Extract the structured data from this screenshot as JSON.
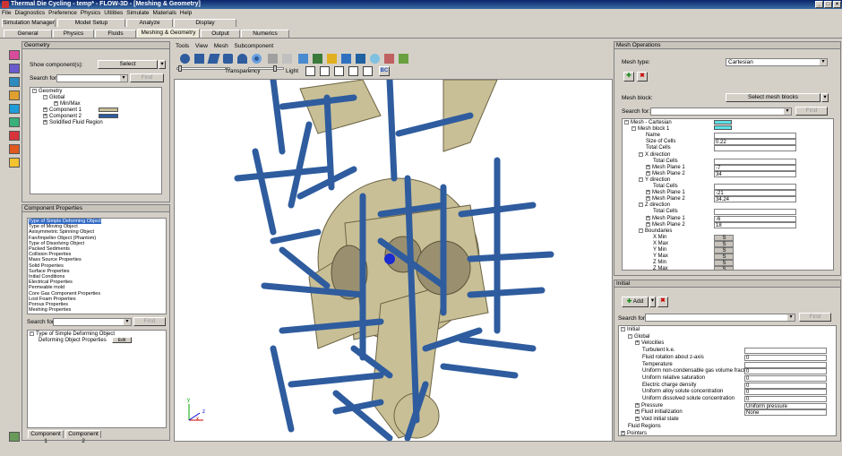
{
  "window": {
    "title": "Thermal Die Cycling - temp* - FLOW-3D - [Meshing & Geometry]"
  },
  "menu": [
    "File",
    "Diagnostics",
    "Preference",
    "Physics",
    "Utilities",
    "Simulate",
    "Materials",
    "Help"
  ],
  "tabs_top": [
    "Simulation Manager",
    "Model Setup",
    "Analyze",
    "Display"
  ],
  "tabs_sub": [
    "General",
    "Physics",
    "Fluids",
    "Meshing & Geometry",
    "Output",
    "Numerics"
  ],
  "geometry": {
    "title": "Geometry",
    "show_label": "Show component(s):",
    "show_value": "Select",
    "search_label": "Search for:",
    "find": "Find",
    "tree": [
      "Geometry",
      "Global",
      "Min/Max",
      "Component 1",
      "Component 2",
      "Solidified Fluid Region"
    ]
  },
  "component_properties": {
    "title": "Component Properties",
    "items": [
      "Type of Simple Deforming Object",
      "Type of Moving Object",
      "Axisymmetric Spinning Object",
      "Fan/Impeller Object (Phantom)",
      "Type of Dissolving Object",
      "Packed Sediments",
      "Collision Properties",
      "Mass Source Properties",
      "Solid Properties",
      "Surface Properties",
      "Initial Conditions",
      "Electrical Properties",
      "Permeable mold",
      "Core Gas Component Properties",
      "Lost Foam Properties",
      "Porous Properties",
      "Meshing Properties"
    ],
    "search_label": "Search for:",
    "find": "Find",
    "subtree": [
      "Type of Simple Deforming Object",
      "Deforming Object Properties"
    ],
    "edit": "Edit",
    "tabs": [
      "Component 1",
      "Component 2"
    ]
  },
  "toolbar": {
    "menus": [
      "Tools",
      "View",
      "Mesh",
      "Subcomponent"
    ],
    "transparency": "Transparency",
    "light": "Light",
    "bc": "BC"
  },
  "mesh_ops": {
    "title": "Mesh Operations",
    "mesh_type_label": "Mesh type:",
    "mesh_type": "Cartesian",
    "mesh_block_label": "Mesh block:",
    "select_blocks": "Select mesh blocks",
    "search_label": "Search for:",
    "find": "Find",
    "rows": [
      {
        "label": "Mesh - Cartesian",
        "ind": 0,
        "toggle": "-",
        "value": ""
      },
      {
        "label": "Mesh block 1",
        "ind": 1,
        "toggle": "-",
        "value": ""
      },
      {
        "label": "Name",
        "ind": 3,
        "toggle": "",
        "value": ""
      },
      {
        "label": "Size of Cells",
        "ind": 3,
        "toggle": "",
        "value": "0.22"
      },
      {
        "label": "Total Cells",
        "ind": 3,
        "toggle": "",
        "value": ""
      },
      {
        "label": "X direction",
        "ind": 2,
        "toggle": "-",
        "value": ""
      },
      {
        "label": "Total Cells",
        "ind": 4,
        "toggle": "",
        "value": ""
      },
      {
        "label": "Mesh Plane 1",
        "ind": 3,
        "toggle": "+",
        "value": "-7"
      },
      {
        "label": "Mesh Plane 2",
        "ind": 3,
        "toggle": "+",
        "value": "34"
      },
      {
        "label": "Y direction",
        "ind": 2,
        "toggle": "-",
        "value": ""
      },
      {
        "label": "Total Cells",
        "ind": 4,
        "toggle": "",
        "value": ""
      },
      {
        "label": "Mesh Plane 1",
        "ind": 3,
        "toggle": "+",
        "value": "-21"
      },
      {
        "label": "Mesh Plane 2",
        "ind": 3,
        "toggle": "+",
        "value": "34.24"
      },
      {
        "label": "Z direction",
        "ind": 2,
        "toggle": "-",
        "value": ""
      },
      {
        "label": "Total Cells",
        "ind": 4,
        "toggle": "",
        "value": ""
      },
      {
        "label": "Mesh Plane 1",
        "ind": 3,
        "toggle": "+",
        "value": "-6"
      },
      {
        "label": "Mesh Plane 2",
        "ind": 3,
        "toggle": "+",
        "value": "18"
      },
      {
        "label": "Boundaries",
        "ind": 2,
        "toggle": "-",
        "value": ""
      },
      {
        "label": "X Min",
        "ind": 4,
        "toggle": "",
        "value": "S"
      },
      {
        "label": "X Max",
        "ind": 4,
        "toggle": "",
        "value": "S"
      },
      {
        "label": "Y Min",
        "ind": 4,
        "toggle": "",
        "value": "S"
      },
      {
        "label": "Y Max",
        "ind": 4,
        "toggle": "",
        "value": "S"
      },
      {
        "label": "Z Min",
        "ind": 4,
        "toggle": "",
        "value": "S"
      },
      {
        "label": "Z Max",
        "ind": 4,
        "toggle": "",
        "value": "S"
      }
    ]
  },
  "initial": {
    "title": "Initial",
    "add": "Add",
    "search_label": "Search for:",
    "find": "Find",
    "rows": [
      {
        "label": "Initial",
        "ind": 0,
        "toggle": "-",
        "value": ""
      },
      {
        "label": "Global",
        "ind": 1,
        "toggle": "-",
        "value": ""
      },
      {
        "label": "Velocities",
        "ind": 2,
        "toggle": "+",
        "value": ""
      },
      {
        "label": "Turbulent k.e.",
        "ind": 3,
        "toggle": "",
        "value": ""
      },
      {
        "label": "Fluid rotation about z-axis",
        "ind": 3,
        "toggle": "",
        "value": "0"
      },
      {
        "label": "Temperature",
        "ind": 3,
        "toggle": "",
        "value": ""
      },
      {
        "label": "Uniform non-condensable gas volume fraction",
        "ind": 3,
        "toggle": "",
        "value": "0"
      },
      {
        "label": "Uniform relative saturation",
        "ind": 3,
        "toggle": "",
        "value": "0"
      },
      {
        "label": "Electric charge density",
        "ind": 3,
        "toggle": "",
        "value": "0"
      },
      {
        "label": "Uniform alloy solute concentration",
        "ind": 3,
        "toggle": "",
        "value": "0"
      },
      {
        "label": "Uniform dissolved solute concentration",
        "ind": 3,
        "toggle": "",
        "value": "0"
      },
      {
        "label": "Pressure",
        "ind": 2,
        "toggle": "+",
        "value": "Uniform pressure"
      },
      {
        "label": "Fluid initialization",
        "ind": 2,
        "toggle": "+",
        "value": "None"
      },
      {
        "label": "Void initial state",
        "ind": 2,
        "toggle": "+",
        "value": ""
      },
      {
        "label": "Fluid Regions",
        "ind": 1,
        "toggle": "",
        "value": ""
      },
      {
        "label": "Pointers",
        "ind": 0,
        "toggle": "+",
        "value": ""
      }
    ]
  },
  "axes": {
    "x": "x",
    "y": "y",
    "z": "z"
  },
  "colors": {
    "tan": "#c9bf96",
    "rod": "#2e5c9e",
    "highlight": "#5ee0e8"
  }
}
